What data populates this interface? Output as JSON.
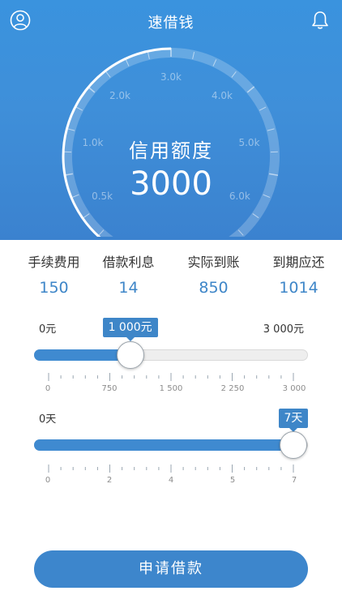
{
  "header": {
    "title": "速借钱",
    "left_icon": "user-icon",
    "right_icon": "bell-icon"
  },
  "gauge": {
    "title": "信用额度",
    "value": "3000",
    "ticks": [
      "0.5k",
      "1.0k",
      "2.0k",
      "3.0k",
      "4.0k",
      "5.0k",
      "6.0k"
    ],
    "progress_fraction": 0.5
  },
  "stats": [
    {
      "label": "手续费用",
      "value": "150"
    },
    {
      "label": "借款利息",
      "value": "14"
    },
    {
      "label": "实际到账",
      "value": "850"
    },
    {
      "label": "到期应还",
      "value": "1014"
    }
  ],
  "amount_slider": {
    "min_label": "0元",
    "max_label": "3 000元",
    "current_label": "1 000元",
    "fraction": 0.333,
    "tick_labels": [
      "0",
      "750",
      "1 500",
      "2 250",
      "3 000"
    ]
  },
  "days_slider": {
    "min_label": "0天",
    "current_label": "7天",
    "fraction": 1.0,
    "tick_labels": [
      "0",
      "2",
      "4",
      "5",
      "7"
    ]
  },
  "apply_button": {
    "label": "申请借款"
  },
  "colors": {
    "primary": "#3e86c8",
    "header_bg": "#3a93de",
    "text": "#333333"
  }
}
